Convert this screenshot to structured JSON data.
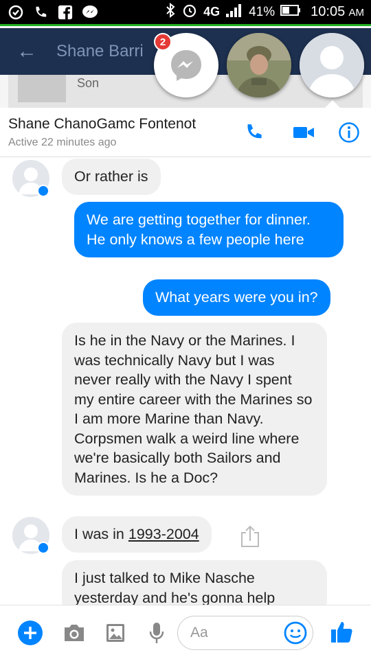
{
  "status_bar": {
    "network": "4G",
    "battery": "41%",
    "time": "10:05",
    "ampm": "AM"
  },
  "underlying": {
    "title": "Shane Barri",
    "relation": "Son"
  },
  "chat_heads": {
    "unread_badge": "2"
  },
  "conversation": {
    "name": "Shane ChanoGamc Fontenot",
    "status": "Active 22 minutes ago"
  },
  "messages": [
    {
      "from": "them",
      "text": "Or rather is"
    },
    {
      "from": "me",
      "text": "We are getting together for dinner. He only knows a few people here"
    },
    {
      "from": "me",
      "text": "What years were you in?"
    },
    {
      "from": "them",
      "text": "Is he in the Navy or the Marines. I was technically Navy but I was never really with the Navy I spent my entire career with the Marines so I am more Marine than Navy. Corpsmen walk a weird line where we're basically both Sailors and Marines. Is he a Doc?"
    },
    {
      "from": "them",
      "text_prefix": "I was in ",
      "text_link": "1993-2004"
    },
    {
      "from": "them",
      "text": "I just talked to Mike Nasche yesterday and he's gonna help"
    }
  ],
  "composer": {
    "placeholder": "Aa"
  },
  "colors": {
    "messenger_blue": "#0084ff",
    "header_navy": "#1d3050",
    "badge_red": "#e53935"
  }
}
